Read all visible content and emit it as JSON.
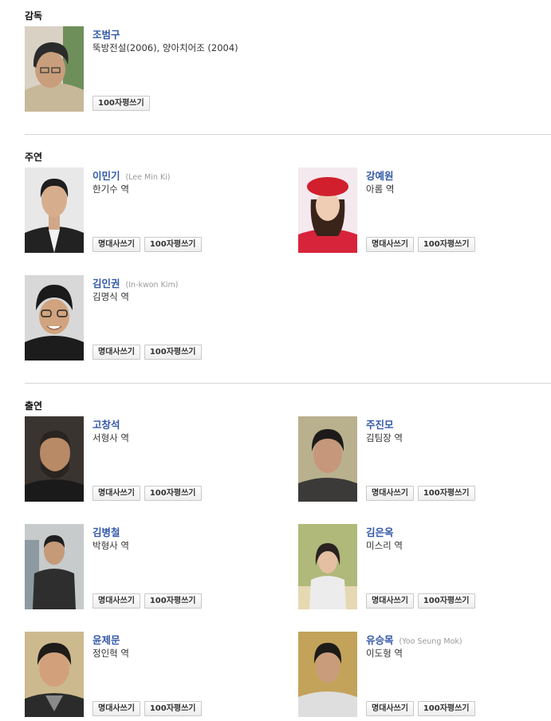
{
  "sections": {
    "director": "감독",
    "lead": "주연",
    "supporting": "출연"
  },
  "buttons": {
    "famous_line": "명대사쓰기",
    "review": "100자평쓰기"
  },
  "director": {
    "name": "조범구",
    "works": "뚝방전설(2006), 양아치어조 (2004)"
  },
  "lead_cast": [
    {
      "name": "이민기",
      "english": "(Lee Min Ki)",
      "role": "한기수 역"
    },
    {
      "name": "강예원",
      "english": "",
      "role": "아롬 역"
    },
    {
      "name": "김인권",
      "english": "(In-kwon Kim)",
      "role": "김명식 역"
    }
  ],
  "supporting_cast": [
    {
      "name": "고창석",
      "english": "",
      "role": "서형사 역"
    },
    {
      "name": "주진모",
      "english": "",
      "role": "김팀장 역"
    },
    {
      "name": "김병철",
      "english": "",
      "role": "박형사 역"
    },
    {
      "name": "김은옥",
      "english": "",
      "role": "미스리 역"
    },
    {
      "name": "윤제문",
      "english": "",
      "role": "정인혁 역"
    },
    {
      "name": "유승목",
      "english": "(Yoo Seung Mok)",
      "role": "이도형 역"
    }
  ]
}
